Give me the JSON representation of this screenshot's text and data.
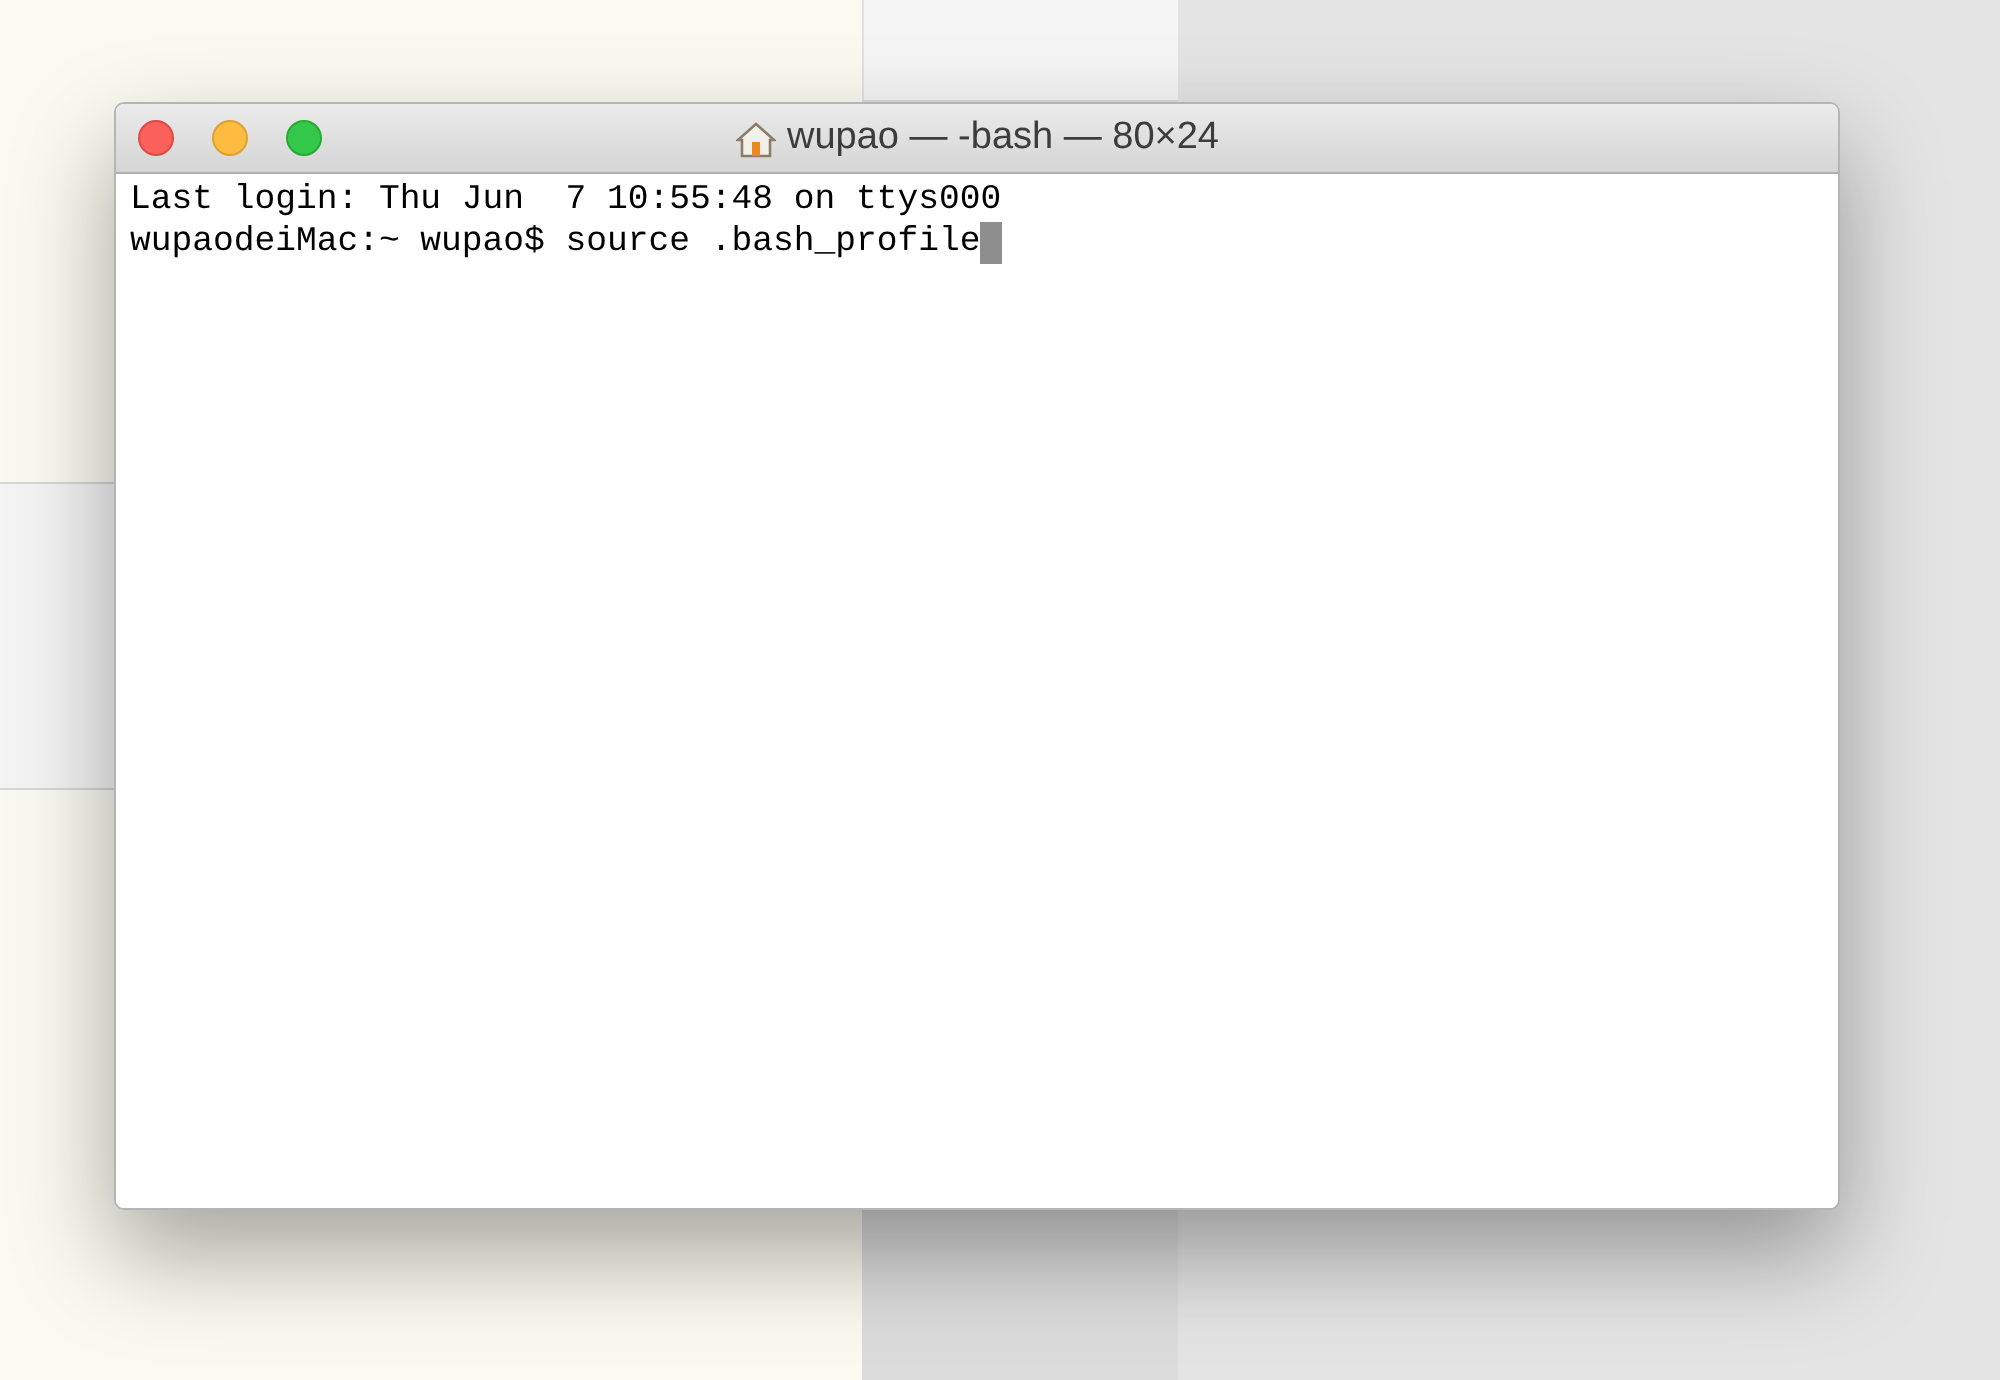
{
  "window": {
    "title": "wupao — -bash — 80×24"
  },
  "terminal": {
    "lines": [
      "Last login: Thu Jun  7 10:55:48 on ttys000",
      "wupaodeiMac:~ wupao$ source .bash_profile"
    ]
  }
}
